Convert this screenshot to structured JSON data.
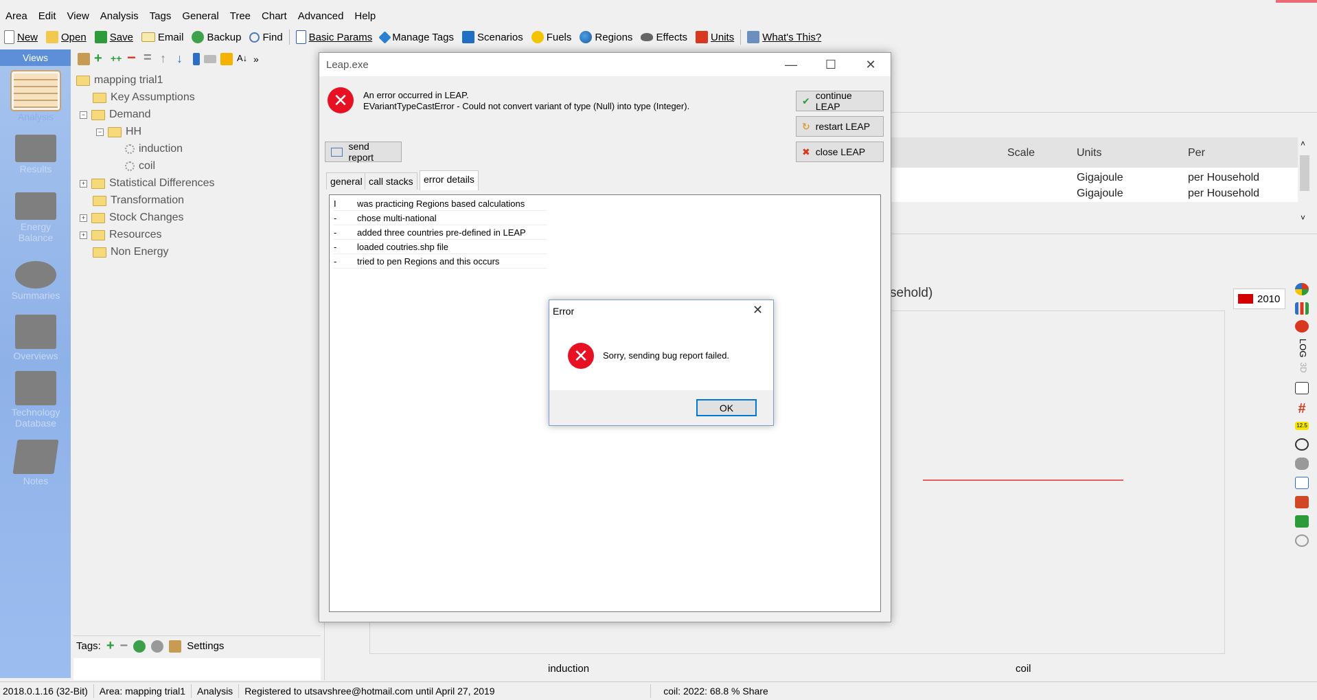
{
  "menu": [
    "Area",
    "Edit",
    "View",
    "Analysis",
    "Tags",
    "General",
    "Tree",
    "Chart",
    "Advanced",
    "Help"
  ],
  "toolbar": [
    {
      "label": "New",
      "icon": "new-document-icon"
    },
    {
      "label": "Open",
      "icon": "open-folder-icon"
    },
    {
      "label": "Save",
      "icon": "save-icon"
    },
    {
      "label": "Email",
      "icon": "email-icon"
    },
    {
      "label": "Backup",
      "icon": "backup-icon"
    },
    {
      "label": "Find",
      "icon": "search-icon"
    },
    {
      "label": "Basic Params",
      "icon": "basic-params-icon"
    },
    {
      "label": "Manage Tags",
      "icon": "tag-icon"
    },
    {
      "label": "Scenarios",
      "icon": "scenarios-icon"
    },
    {
      "label": "Fuels",
      "icon": "fuels-icon"
    },
    {
      "label": "Regions",
      "icon": "globe-icon"
    },
    {
      "label": "Effects",
      "icon": "effects-icon"
    },
    {
      "label": "Units",
      "icon": "units-icon"
    },
    {
      "label": "What's This?",
      "icon": "help-icon"
    }
  ],
  "views": {
    "header": "Views",
    "items": [
      "Analysis",
      "Results",
      "Energy Balance",
      "Summaries",
      "Overviews",
      "Technology Database",
      "Notes"
    ]
  },
  "tree": {
    "root": "mapping trial1",
    "nodes": [
      "Key Assumptions",
      "Demand",
      "HH",
      "induction",
      "coil",
      "Statistical Differences",
      "Transformation",
      "Stock Changes",
      "Resources",
      "Non Energy"
    ]
  },
  "tags": {
    "label": "Tags:",
    "settings": "Settings"
  },
  "table": {
    "headers": [
      "Scale",
      "Units",
      "Per"
    ],
    "rows": [
      [
        "Gigajoule",
        "per Household"
      ],
      [
        "Gigajoule",
        "per Household"
      ]
    ]
  },
  "chart": {
    "title_fragment": "sehold)",
    "categories": [
      "induction",
      "coil"
    ],
    "legend": "2010",
    "legend_color": "#d40000"
  },
  "status": {
    "version": "2018.0.1.16 (32-Bit)",
    "area": "Area: mapping trial1",
    "view": "Analysis",
    "registered": "Registered to utsavshree@hotmail.com until April 27, 2019",
    "share": "coil: 2022: 68.8 % Share"
  },
  "leap_dialog": {
    "title": "Leap.exe",
    "message1": "An error occurred in LEAP.",
    "message2": "EVariantTypeCastError - Could not convert variant of type (Null) into type (Integer).",
    "continue": "continue LEAP",
    "restart": "restart LEAP",
    "close": "close LEAP",
    "send_report": "send report",
    "tabs": [
      "general",
      "call stacks",
      "error details"
    ],
    "details": [
      {
        "mark": "I",
        "text": "was practicing Regions based calculations"
      },
      {
        "mark": "-",
        "text": "chose multi-national"
      },
      {
        "mark": "-",
        "text": "added three countries pre-defined in LEAP"
      },
      {
        "mark": "-",
        "text": "loaded coutries.shp file"
      },
      {
        "mark": "-",
        "text": "tried to pen Regions and this occurs"
      }
    ]
  },
  "error_dialog": {
    "title": "Error",
    "message": "Sorry, sending bug report failed.",
    "ok": "OK"
  },
  "colors": {
    "views_bg": "#9cbdef",
    "error_red": "#e81123",
    "accent": "#0078d7"
  }
}
